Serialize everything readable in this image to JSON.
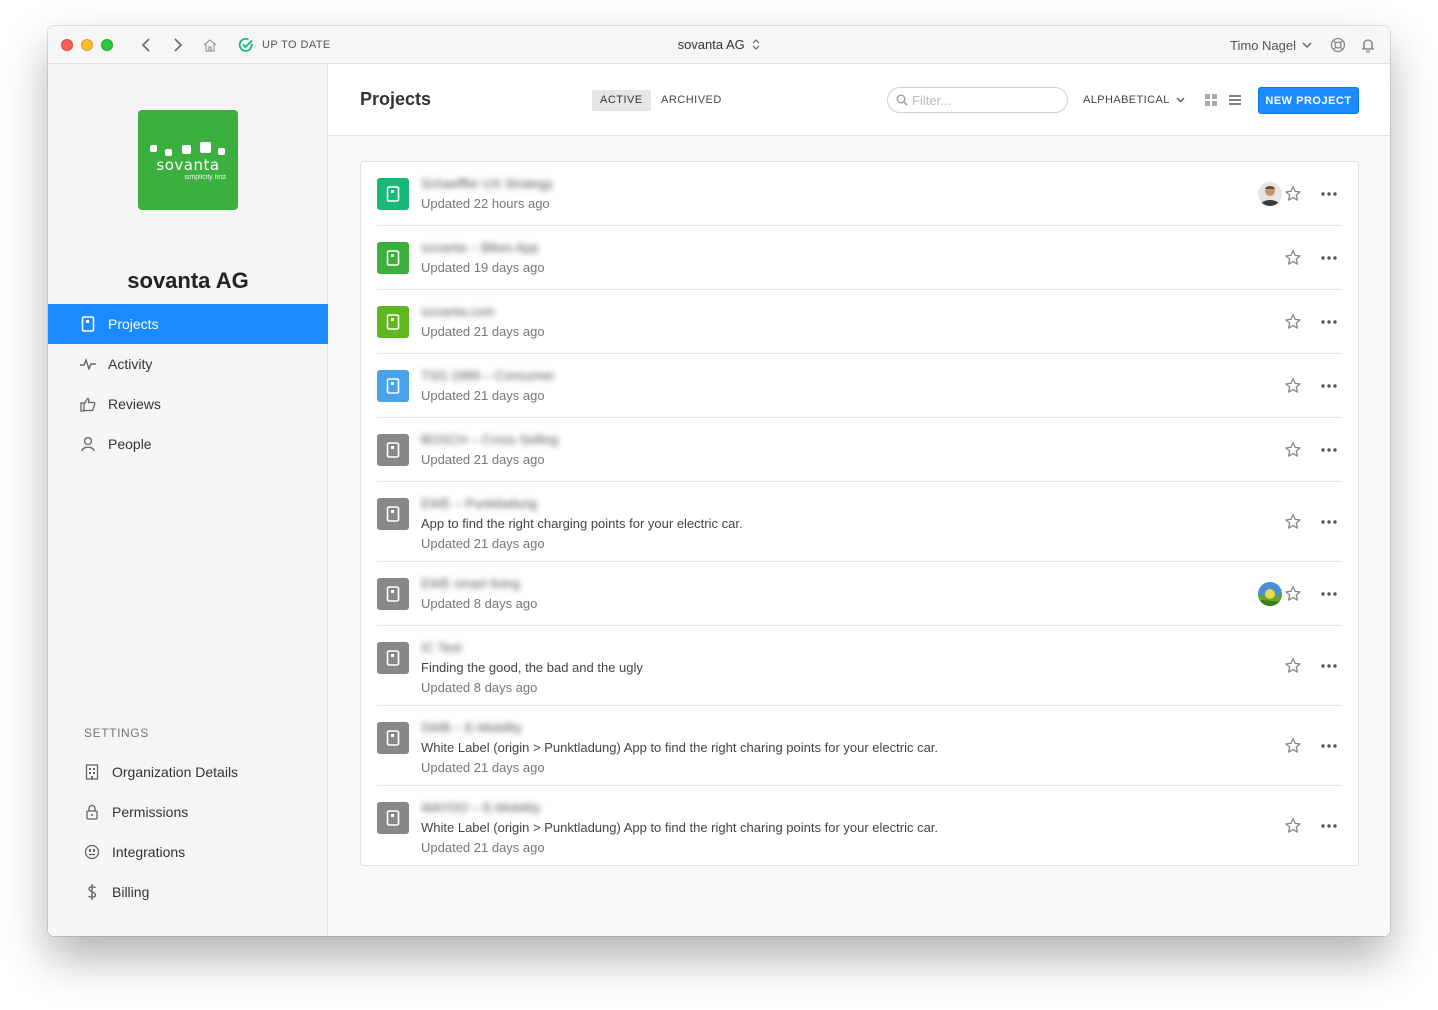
{
  "titlebar": {
    "sync_status": "UP TO DATE",
    "org_switcher": "sovanta AG",
    "user_name": "Timo Nagel"
  },
  "sidebar": {
    "logo": {
      "word": "sovanta",
      "tagline": "simplicity first",
      "color": "#3bb03f"
    },
    "org_name": "sovanta AG",
    "nav": [
      {
        "label": "Projects",
        "icon": "project-icon",
        "active": true
      },
      {
        "label": "Activity",
        "icon": "pulse-icon"
      },
      {
        "label": "Reviews",
        "icon": "thumbs-up-icon"
      },
      {
        "label": "People",
        "icon": "person-icon"
      }
    ],
    "settings_title": "SETTINGS",
    "settings": [
      {
        "label": "Organization Details",
        "icon": "building-icon"
      },
      {
        "label": "Permissions",
        "icon": "lock-icon"
      },
      {
        "label": "Integrations",
        "icon": "plug-icon"
      },
      {
        "label": "Billing",
        "icon": "dollar-icon"
      }
    ]
  },
  "header": {
    "title": "Projects",
    "tabs": [
      {
        "label": "ACTIVE",
        "active": true
      },
      {
        "label": "ARCHIVED"
      }
    ],
    "filter_placeholder": "Filter...",
    "sort_label": "ALPHABETICAL",
    "new_project_label": "NEW PROJECT"
  },
  "projects": [
    {
      "name": "Schaeffler UX Strategy",
      "description": "",
      "updated": "Updated 22 hours ago",
      "color": "#17b978",
      "avatar": "person"
    },
    {
      "name": "sovanta – Bikes App",
      "description": "",
      "updated": "Updated 19 days ago",
      "color": "#3bb03f"
    },
    {
      "name": "sovanta.com",
      "description": "",
      "updated": "Updated 21 days ago",
      "color": "#5fb61f"
    },
    {
      "name": "TSG 1899 – Consumer",
      "description": "",
      "updated": "Updated 21 days ago",
      "color": "#4aa3ea"
    },
    {
      "name": "BOSCH – Cross Selling",
      "description": "",
      "updated": "Updated 21 days ago",
      "color": "#888888"
    },
    {
      "name": "EWE – Punktladung",
      "description": "App to find the right charging points for your electric car.",
      "updated": "Updated 21 days ago",
      "color": "#888888"
    },
    {
      "name": "EWE smart living",
      "description": "",
      "updated": "Updated 8 days ago",
      "color": "#888888",
      "avatar": "landscape"
    },
    {
      "name": "IC Test",
      "description": "Finding the good, the bad and the ugly",
      "updated": "Updated 8 days ago",
      "color": "#888888"
    },
    {
      "name": "SWB – E-Mobility",
      "description": "White Label (origin > Punktladung) App to find the right charing points for your electric car.",
      "updated": "Updated 21 days ago",
      "color": "#888888"
    },
    {
      "name": "WAYDO – E-Mobility",
      "description": "White Label (origin > Punktladung) App to find the right charing points for your electric car.",
      "updated": "Updated 21 days ago",
      "color": "#888888"
    }
  ],
  "accent": "#1a8cff"
}
